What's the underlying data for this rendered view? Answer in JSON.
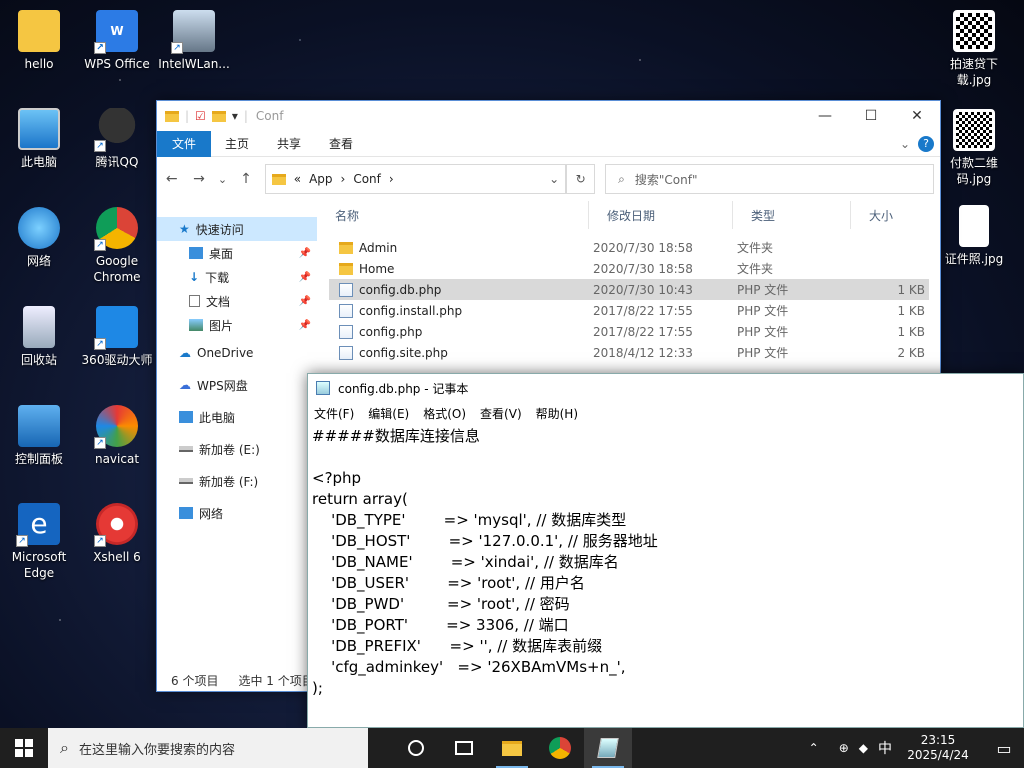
{
  "desktop": {
    "icons": [
      {
        "label": "hello"
      },
      {
        "label": "WPS Office"
      },
      {
        "label": "IntelWLan..."
      },
      {
        "label": "此电脑"
      },
      {
        "label": "腾讯QQ"
      },
      {
        "label": "网络"
      },
      {
        "label": "Google Chrome"
      },
      {
        "label": "回收站"
      },
      {
        "label": "360驱动大师"
      },
      {
        "label": "控制面板"
      },
      {
        "label": "navicat"
      },
      {
        "label": "Microsoft Edge"
      },
      {
        "label": "Xshell 6"
      },
      {
        "label": "拍速贷下载.jpg"
      },
      {
        "label": "付款二维码.jpg"
      },
      {
        "label": "证件照.jpg"
      }
    ]
  },
  "explorer": {
    "title": "Conf",
    "ribbon": {
      "file": "文件",
      "tabs": [
        "主页",
        "共享",
        "查看"
      ],
      "chevron": "⌄",
      "help": "?"
    },
    "nav": {
      "back": "←",
      "forward": "→",
      "down": "⌄",
      "up": "↑"
    },
    "address": {
      "prefix": "«",
      "parts": [
        "App",
        "Conf"
      ],
      "sep": "›"
    },
    "search_placeholder": "搜索\"Conf\"",
    "navpane": [
      {
        "label": "快速访问"
      },
      {
        "label": "桌面"
      },
      {
        "label": "下载"
      },
      {
        "label": "文档"
      },
      {
        "label": "图片"
      },
      {
        "label": "OneDrive"
      },
      {
        "label": "WPS网盘"
      },
      {
        "label": "此电脑"
      },
      {
        "label": "新加卷 (E:)"
      },
      {
        "label": "新加卷 (F:)"
      },
      {
        "label": "网络"
      }
    ],
    "columns": [
      "名称",
      "修改日期",
      "类型",
      "大小"
    ],
    "rows": [
      {
        "name": "Admin",
        "date": "2020/7/30 18:58",
        "type": "文件夹",
        "size": ""
      },
      {
        "name": "Home",
        "date": "2020/7/30 18:58",
        "type": "文件夹",
        "size": ""
      },
      {
        "name": "config.db.php",
        "date": "2020/7/30 10:43",
        "type": "PHP 文件",
        "size": "1 KB"
      },
      {
        "name": "config.install.php",
        "date": "2017/8/22 17:55",
        "type": "PHP 文件",
        "size": "1 KB"
      },
      {
        "name": "config.php",
        "date": "2017/8/22 17:55",
        "type": "PHP 文件",
        "size": "1 KB"
      },
      {
        "name": "config.site.php",
        "date": "2018/4/12 12:33",
        "type": "PHP 文件",
        "size": "2 KB"
      }
    ],
    "status": {
      "count": "6 个项目",
      "selected": "选中 1 个项目"
    }
  },
  "notepad": {
    "title": "config.db.php - 记事本",
    "menu": [
      "文件(F)",
      "编辑(E)",
      "格式(O)",
      "查看(V)",
      "帮助(H)"
    ],
    "content": "#####数据库连接信息\n\n<?php\nreturn array(\n    'DB_TYPE'        => 'mysql', // 数据库类型\n    'DB_HOST'        => '127.0.0.1', // 服务器地址\n    'DB_NAME'        => 'xindai', // 数据库名\n    'DB_USER'        => 'root', // 用户名\n    'DB_PWD'         => 'root', // 密码\n    'DB_PORT'        => 3306, // 端口\n    'DB_PREFIX'      => '', // 数据库表前缀\n    'cfg_adminkey'   => '26XBAmVMs+n_',\n);"
  },
  "taskbar": {
    "search_placeholder": "在这里输入你要搜索的内容",
    "ime": "中",
    "time": "23:15",
    "date": "2025/4/24"
  }
}
